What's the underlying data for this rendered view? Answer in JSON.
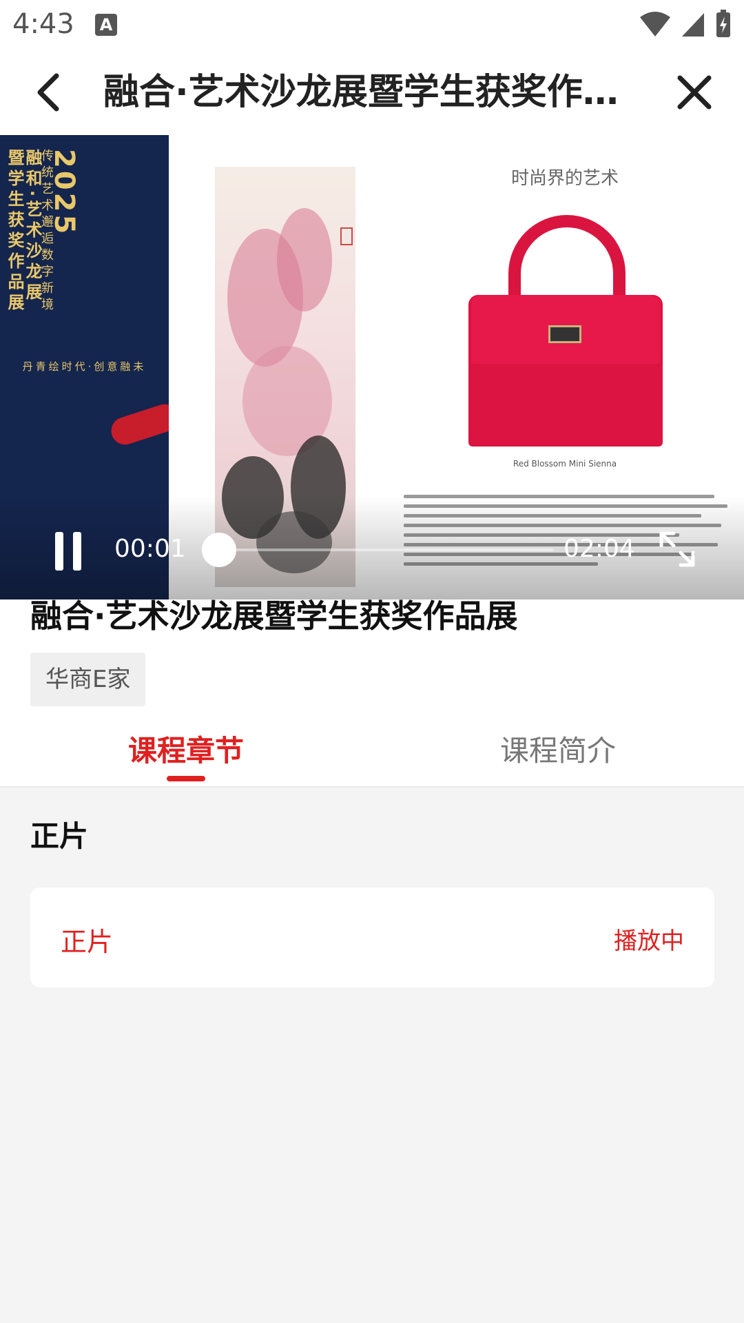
{
  "status_bar": {
    "time": "4:43",
    "notification_icon": "A",
    "icons": [
      "wifi-icon",
      "signal-icon",
      "battery-charging-icon"
    ]
  },
  "header": {
    "title": "融合·艺术沙龙展暨学生获奖作品展",
    "back_icon": "chevron-left-icon",
    "close_icon": "close-icon"
  },
  "video": {
    "poster_year": "2025",
    "poster_title_1": "融和·艺术沙龙展",
    "poster_title_2": "暨学生获奖作品展",
    "poster_subtitle": "传统艺术邂逅数字新境",
    "poster_slogan": "丹青绘时代·创意融未",
    "fashion_heading": "时尚界的艺术",
    "bag_caption": "Red Blossom Mini Sienna",
    "current_time": "00:01",
    "total_time": "02:04",
    "progress": 0.008,
    "state": "playing",
    "pause_icon": "pause-icon",
    "fullscreen_icon": "fullscreen-icon"
  },
  "course": {
    "title": "融合·艺术沙龙展暨学生获奖作品展",
    "tag": "华商E家"
  },
  "tabs": [
    {
      "label": "课程章节",
      "active": true
    },
    {
      "label": "课程简介",
      "active": false
    }
  ],
  "chapters": {
    "section_label": "正片",
    "items": [
      {
        "name": "正片",
        "status": "播放中"
      }
    ]
  },
  "colors": {
    "accent": "#e02020",
    "background": "#f4f4f4",
    "card": "#ffffff"
  }
}
